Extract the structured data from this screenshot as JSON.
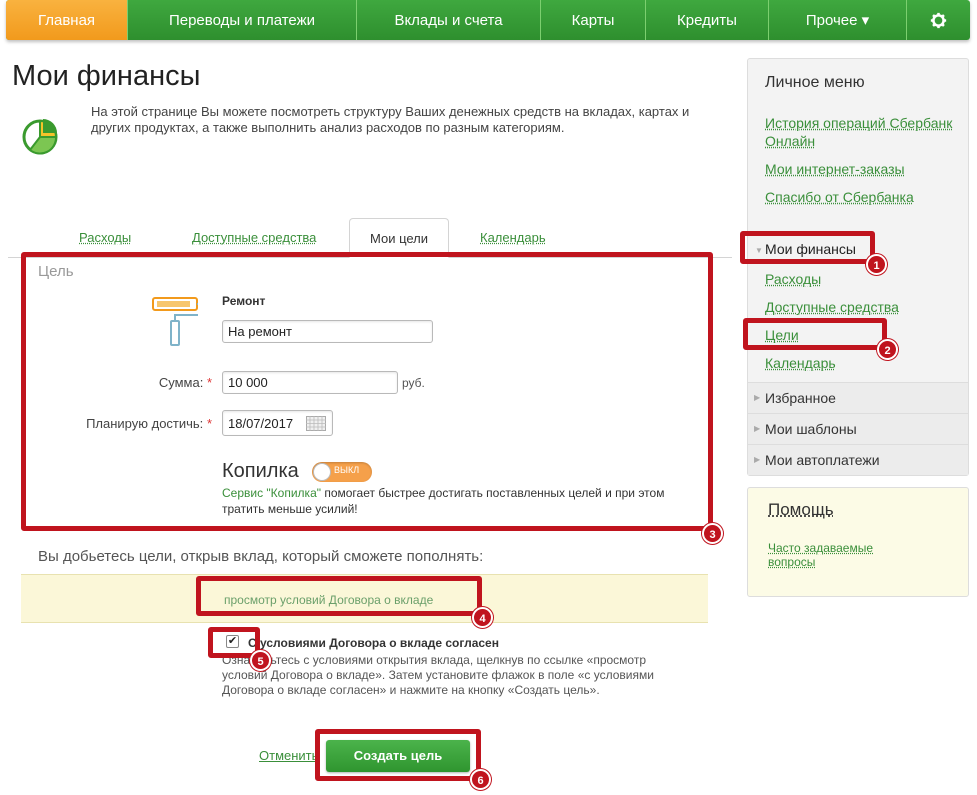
{
  "nav": {
    "items": [
      {
        "label": "Главная",
        "active": true
      },
      {
        "label": "Переводы и платежи",
        "active": false
      },
      {
        "label": "Вклады и счета",
        "active": false
      },
      {
        "label": "Карты",
        "active": false
      },
      {
        "label": "Кредиты",
        "active": false
      },
      {
        "label": "Прочее ▾",
        "active": false
      }
    ],
    "settings_icon": "gear-icon"
  },
  "page": {
    "title": "Мои финансы",
    "intro": "На этой странице Вы можете посмотреть структуру Ваших денежных средств на вкладах, картах и других продуктах, а также выполнить анализ расходов по разным категориям."
  },
  "tabs": {
    "expenses": "Расходы",
    "available": "Доступные средства",
    "goals": "Мои цели",
    "calendar": "Календарь"
  },
  "form": {
    "section_label": "Цель",
    "goal_title": "Ремонт",
    "goal_name_value": "На ремонт",
    "amount_label": "Сумма:",
    "amount_value": "10 000",
    "amount_unit": "руб.",
    "date_label": "Планирую достичь:",
    "date_value": "18/07/2017",
    "required_mark": "*",
    "kopilka_label": "Копилка",
    "kopilka_toggle": "ВЫКЛ",
    "kopilka_link": "Сервис \"Копилка\"",
    "kopilka_desc": " помогает быстрее достигать поставленных целей и при этом тратить меньше усилий!"
  },
  "deposit": {
    "heading": "Вы добьетесь цели, открыв вклад, который сможете пополнять:",
    "contract_link": "просмотр условий Договора о вкладе",
    "agree_label": "С условиями Договора о вкладе согласен",
    "agree_checked": true,
    "agree_desc": "Ознакомьтесь с условиями открытия вклада, щелкнув по ссылке «просмотр условий Договора о вкладе». Затем установите флажок в поле «с условиями Договора о вкладе согласен» и нажмите на кнопку «Создать цель».",
    "cancel_label": "Отменить",
    "create_label": "Создать цель"
  },
  "sidebar": {
    "heading": "Личное меню",
    "links": [
      "История операций Сбербанк Онлайн",
      "Мои интернет-заказы",
      "Спасибо от Сбербанка"
    ],
    "current": "Мои финансы",
    "sub_links": [
      "Расходы",
      "Доступные средства",
      "Цели",
      "Календарь"
    ],
    "sections": [
      "Избранное",
      "Мои шаблоны",
      "Мои автоплатежи"
    ]
  },
  "help": {
    "title": "Помощь",
    "link": "Часто задаваемые вопросы"
  },
  "annotations": [
    "1",
    "2",
    "3",
    "4",
    "5",
    "6"
  ],
  "colors": {
    "brand_green": "#3fa83f",
    "accent_orange": "#f29a1c",
    "annotation_red": "#c0141e"
  }
}
